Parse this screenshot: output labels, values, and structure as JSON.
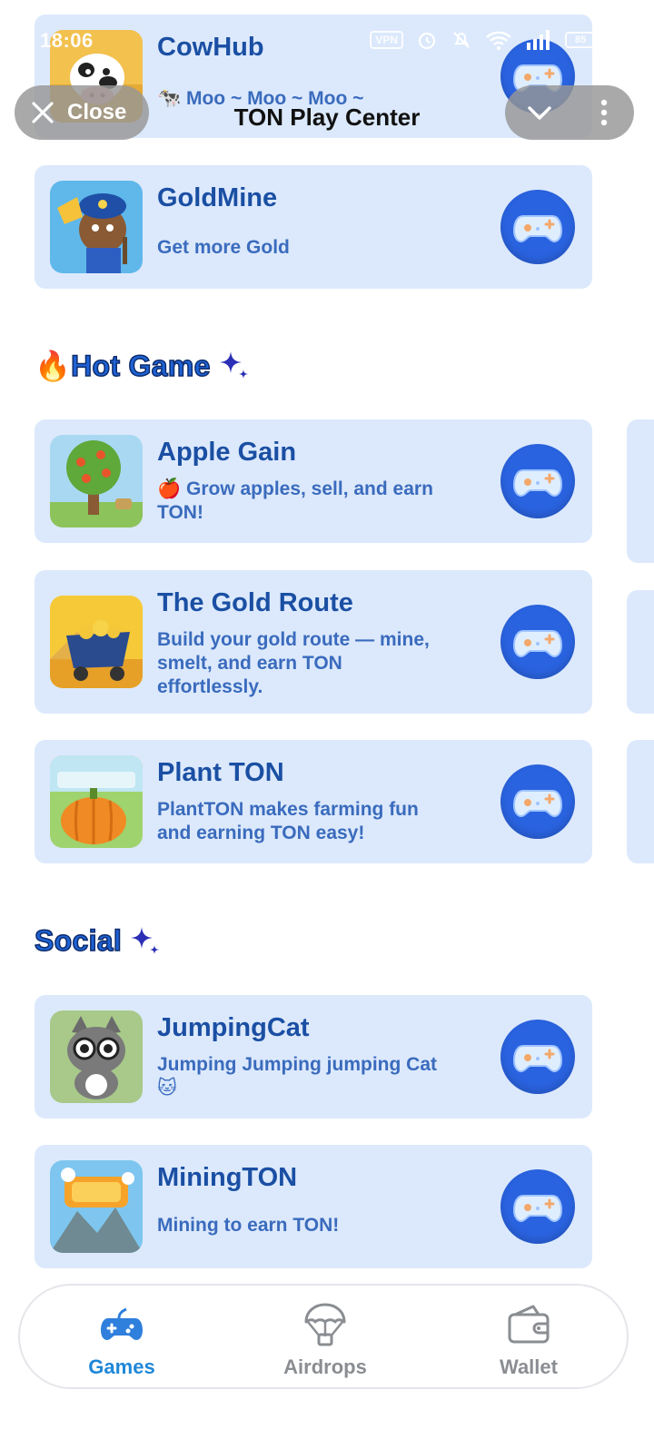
{
  "status_bar": {
    "time": "18:06",
    "vpn": "VPN",
    "battery": "85"
  },
  "header": {
    "close_label": "Close",
    "title": "TON Play Center"
  },
  "games_top": [
    {
      "name": "CowHub",
      "description": "🐄 Moo ~  Moo ~  Moo ~"
    },
    {
      "name": "GoldMine",
      "description": "Get more Gold"
    }
  ],
  "sections": {
    "hot": {
      "title": "🔥Hot Game",
      "items": [
        {
          "name": "Apple Gain",
          "description": "🍎 Grow apples, sell, and earn TON!"
        },
        {
          "name": "The Gold Route",
          "description": "Build your gold route — mine, smelt, and earn TON effortlessly."
        },
        {
          "name": "Plant TON",
          "description": "PlantTON makes farming fun and earning TON easy!"
        }
      ]
    },
    "social": {
      "title": "Social",
      "items": [
        {
          "name": "JumpingCat",
          "description": "Jumping Jumping jumping Cat 🐱"
        },
        {
          "name": "MiningTON",
          "description": "Mining to earn TON!"
        }
      ]
    }
  },
  "bottom_nav": {
    "games": "Games",
    "airdrops": "Airdrops",
    "wallet": "Wallet",
    "active": "Games"
  },
  "colors": {
    "card_bg": "#dce9fc",
    "title_blue": "#1a4fa3",
    "desc_blue": "#3a6bbd",
    "play_button": "#2a63e0",
    "active_nav": "#1f87d8",
    "inactive_nav": "#8a8d92"
  }
}
